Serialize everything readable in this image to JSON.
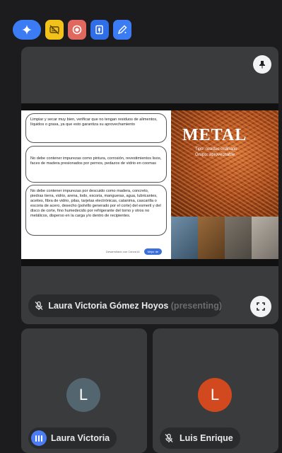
{
  "toolbar": {
    "buttons": [
      {
        "icon": "gemini-sparkle-icon",
        "color": "#3b7cf5"
      },
      {
        "icon": "captions-off-icon",
        "color": "#f2c21b"
      },
      {
        "icon": "record-icon",
        "color": "#e0685f"
      },
      {
        "icon": "transcript-icon",
        "color": "#2f6ee6"
      },
      {
        "icon": "take-notes-icon",
        "color": "#3b7cf5"
      }
    ]
  },
  "main": {
    "slide": {
      "title": "METAL",
      "subtitle_line1": "Tipo: residuo ordinario",
      "subtitle_line2": "Grupo: aprovechable",
      "box1": "Limpiar y secar muy bien, verificar que no tengan residuos de alimentos, líquidos o grasa, ya que esto garantiza su aprovechamiento",
      "box2": "No debe contener impurezas como pintura, corrosión, revestimientos lisos, faces de madera presionados por pernos, pedazos de vidrio en coomas",
      "box3": "No debe contener impurezas por descuido como madera, concreto, piedras tierra, vidrio, arena, lodo, escoria, mangueras, agua, lubricantes, aceites, fibra de vidrio, pilas, tarjetas electrónicas, catanima, cascarilla o escoria de acero, desecho (polvillo generado por el corte) del esmeril y del disco de corte, fino humedecido por refrigerante del torno y otros no metálicos, disperso en la carga y/o dentro de recipientes.",
      "footer_text": "Desarrollado con Canva AI",
      "footer_button": "Mejor de"
    },
    "presenter_name": "Laura Victoria Gómez Hoyos",
    "presenter_suffix": " (presenting)"
  },
  "participants": [
    {
      "initial": "L",
      "name": "Laura Victoria",
      "color": "#53656f",
      "status": "speaking"
    },
    {
      "initial": "L",
      "name": "Luis Enrique",
      "color": "#d2481f",
      "status": "muted"
    }
  ]
}
